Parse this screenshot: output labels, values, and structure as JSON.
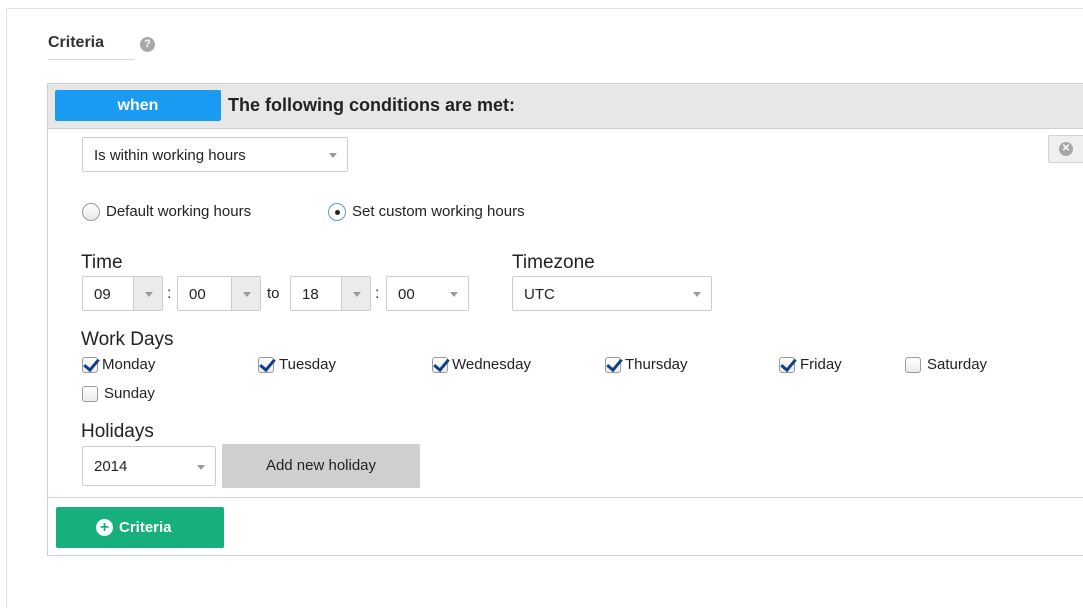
{
  "section": {
    "title": "Criteria",
    "help_icon": "question-circle-icon",
    "help_glyph": "?"
  },
  "condition": {
    "when_label": "when",
    "header_text": "The following conditions are met:",
    "type_select_value": "Is within working hours",
    "remove_icon": "remove-circle-icon",
    "remove_glyph": "✕"
  },
  "hours_mode": {
    "options": [
      {
        "label": "Default working hours",
        "selected": false
      },
      {
        "label": "Set custom working hours",
        "selected": true
      }
    ]
  },
  "time": {
    "label": "Time",
    "start_hour": "09",
    "start_minute": "00",
    "to_label": "to",
    "end_hour": "18",
    "end_minute": "00",
    "separator": ":"
  },
  "timezone": {
    "label": "Timezone",
    "value": "UTC"
  },
  "work_days": {
    "label": "Work Days",
    "days": [
      {
        "name": "Monday",
        "checked": true
      },
      {
        "name": "Tuesday",
        "checked": true
      },
      {
        "name": "Wednesday",
        "checked": true
      },
      {
        "name": "Thursday",
        "checked": true
      },
      {
        "name": "Friday",
        "checked": true
      },
      {
        "name": "Saturday",
        "checked": false
      },
      {
        "name": "Sunday",
        "checked": false
      }
    ]
  },
  "holidays": {
    "label": "Holidays",
    "year": "2014",
    "add_button_label": "Add new holiday"
  },
  "footer": {
    "add_criteria_label": "Criteria",
    "add_icon": "plus-circle-icon",
    "add_glyph": "+"
  },
  "colors": {
    "when_blue": "#1a9bf2",
    "add_green": "#17b07c",
    "header_gray": "#e7e7e7"
  }
}
